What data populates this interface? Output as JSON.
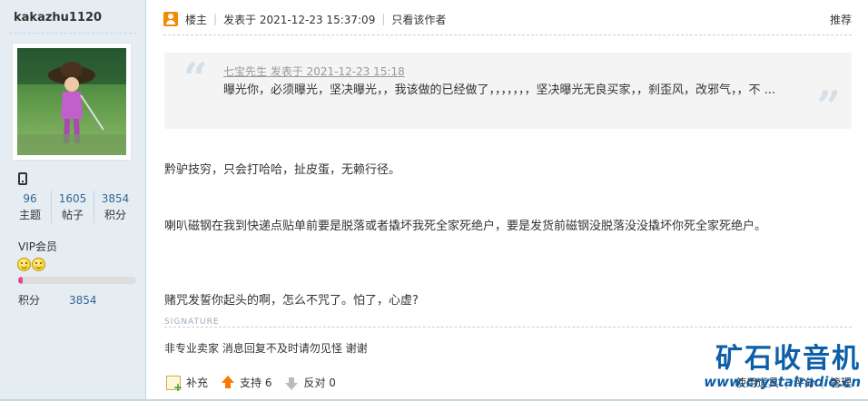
{
  "author": {
    "username": "kakazhu1120",
    "stats": [
      {
        "value": "96",
        "label": "主题"
      },
      {
        "value": "1605",
        "label": "帖子"
      },
      {
        "value": "3854",
        "label": "积分"
      }
    ],
    "group": "VIP会员",
    "level_progress": 0.04,
    "score_label": "积分",
    "score_value": "3854"
  },
  "post": {
    "role": "楼主",
    "posted_at": "发表于 2021-12-23 15:37:09",
    "only_author": "只看该作者",
    "recommend": "推荐",
    "quote": {
      "author": "七宝先生 发表于 2021-12-23 15:18",
      "text": "曝光你，必须曝光，坚决曝光，，我该做的已经做了，，，，，，，坚决曝光无良买家，，刹歪风，改邪气，，不 ..."
    },
    "paragraphs": [
      "黔驴技穷，只会打哈哈，扯皮蛋，无赖行径。",
      "喇叭磁钢在我到快递点贴单前要是脱落或者撬坏我死全家死绝户，要是发货前磁钢没脱落没没撬坏你死全家死绝户。",
      "赌咒发誓你起头的啊，怎么不咒了。怕了，心虚?"
    ],
    "signature_label": "SIGNATURE",
    "signature": "非专业卖家  消息回复不及时请勿见怪 谢谢"
  },
  "actions": {
    "supplement": "补充",
    "support": "支持 6",
    "oppose": "反对 0"
  },
  "tools": {
    "use_item": "使用道具",
    "rate": "评分",
    "manage": "管理"
  },
  "watermark": {
    "title": "矿石收音机",
    "url": "www.crystalradio.cn"
  }
}
